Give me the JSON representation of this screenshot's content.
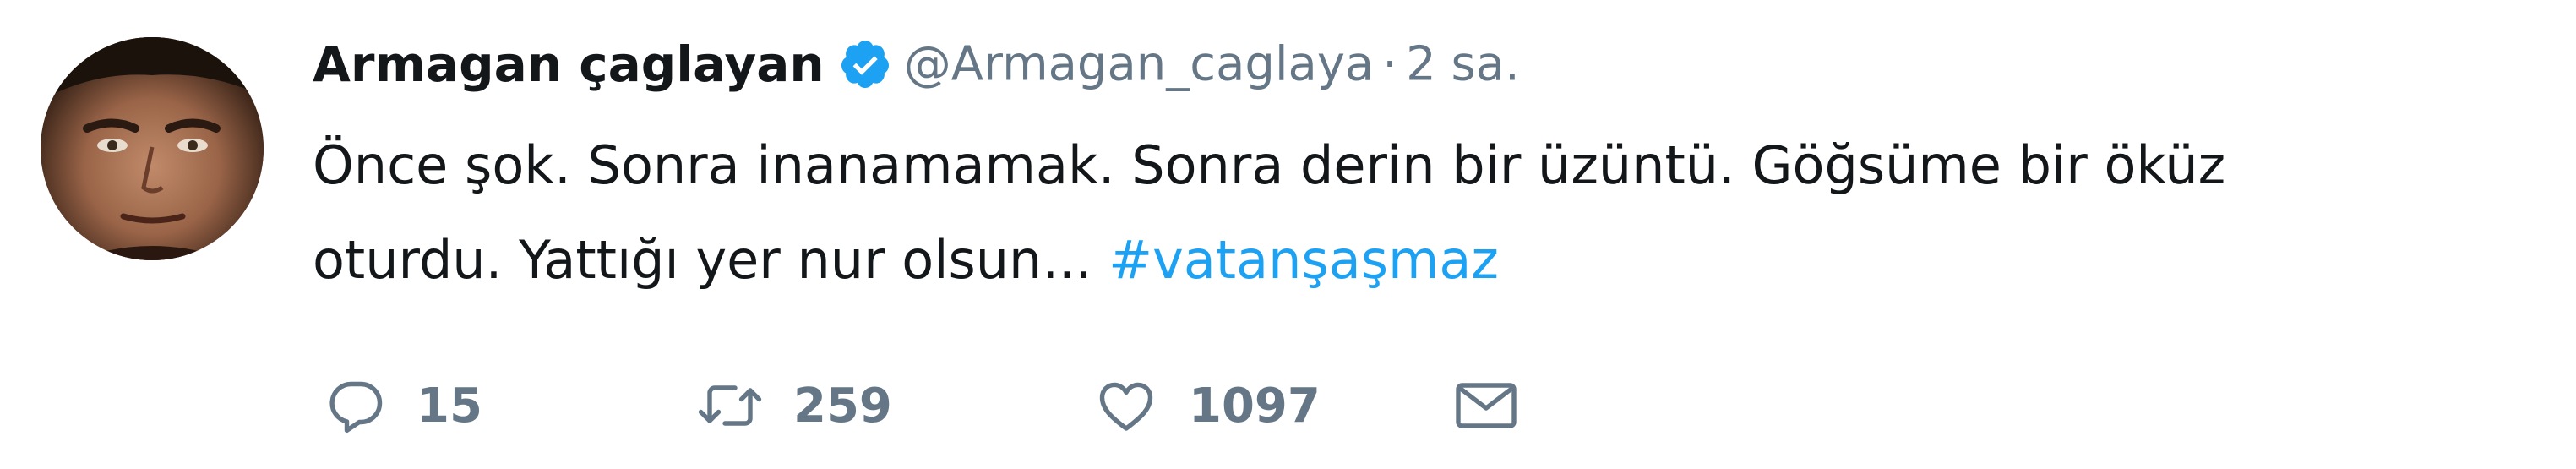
{
  "tweet": {
    "name": "Armagan çaglayan",
    "handle": "@Armagan_caglaya",
    "separator": "·",
    "time": "2 sa.",
    "text_line1": "Önce şok. Sonra inanamamak. Sonra derin bir üzüntü. Göğsüme bir öküz",
    "text_line2": "oturdu. Yattığı yer nur olsun... ",
    "hashtag": "#vatanşaşmaz"
  },
  "actions": {
    "reply_count": "15",
    "retweet_count": "259",
    "like_count": "1097"
  },
  "icons": {
    "avatar": "profile-photo",
    "verified": "verified-badge-icon",
    "reply": "reply-icon",
    "retweet": "retweet-icon",
    "like": "heart-icon",
    "dm": "envelope-icon"
  },
  "colors": {
    "text": "#14171a",
    "secondary": "#657786",
    "link": "#1da1f2",
    "verified": "#1da1f2"
  }
}
